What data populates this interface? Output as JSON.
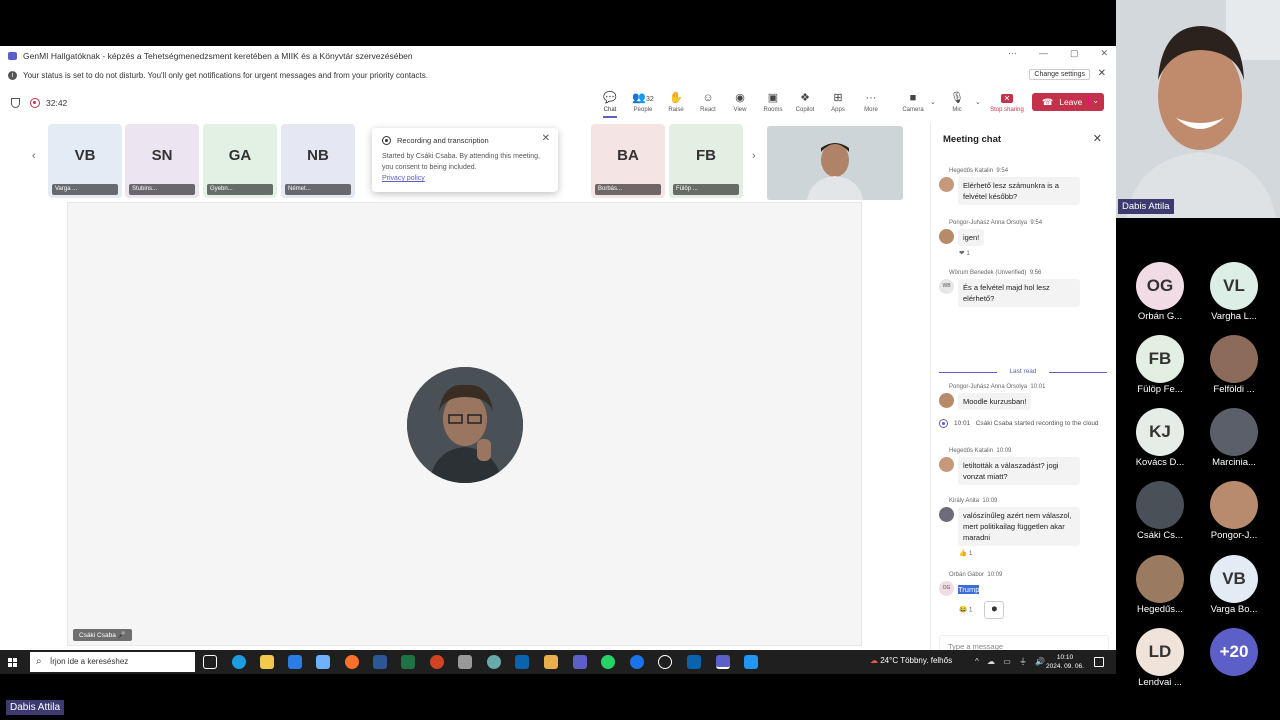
{
  "window": {
    "title": "GenMI Hallgatóknak - képzés a Tehetségmenedzsment keretében a MIIK és a Könyvtár szervezésében",
    "controls": [
      "···",
      "—",
      "▢",
      "✕"
    ]
  },
  "notice": {
    "text": "Your status is set to do not disturb. You'll only get notifications for urgent messages and from your priority contacts.",
    "button": "Change settings"
  },
  "toolbar": {
    "timer": "32:42",
    "tools": [
      {
        "label": "Chat",
        "icon": "chat-icon",
        "glyph": "💬"
      },
      {
        "label": "People",
        "icon": "people-icon",
        "glyph": "👥",
        "count": "32"
      },
      {
        "label": "Raise",
        "icon": "raise-hand-icon",
        "glyph": "✋"
      },
      {
        "label": "React",
        "icon": "react-icon",
        "glyph": "☺"
      },
      {
        "label": "View",
        "icon": "view-icon",
        "glyph": "◉"
      },
      {
        "label": "Rooms",
        "icon": "rooms-icon",
        "glyph": "▣"
      },
      {
        "label": "Copilot",
        "icon": "copilot-icon",
        "glyph": "❖"
      },
      {
        "label": "Apps",
        "icon": "apps-icon",
        "glyph": "⊞"
      },
      {
        "label": "More",
        "icon": "more-icon",
        "glyph": "···"
      },
      {
        "label": "Camera",
        "icon": "camera-icon",
        "glyph": "■"
      },
      {
        "label": "Mic",
        "icon": "mic-icon",
        "glyph": "🎙"
      },
      {
        "label": "Stop sharing",
        "icon": "stop-sharing-icon",
        "glyph": "✕"
      }
    ],
    "leave": "Leave"
  },
  "strip": {
    "participants": [
      {
        "initials": "VB",
        "name": "Varga ...",
        "color": "#e3ecf5"
      },
      {
        "initials": "SN",
        "name": "Stubins...",
        "color": "#ece4f0"
      },
      {
        "initials": "GA",
        "name": "Gyebn...",
        "color": "#e3f0e4"
      },
      {
        "initials": "NB",
        "name": "Német...",
        "color": "#e5e8f3"
      },
      {
        "initials": "BA",
        "name": "Borbás...",
        "color": "#f5e4e4"
      },
      {
        "initials": "FB",
        "name": "Fülöp ...",
        "color": "#e4efe4"
      }
    ]
  },
  "toast": {
    "title": "Recording and transcription",
    "body": "Started by Csáki Csaba. By attending this meeting, you consent to being included.",
    "link": "Privacy policy"
  },
  "stage": {
    "speaker": "Csáki Csaba"
  },
  "chat": {
    "title": "Meeting chat",
    "messages": [
      {
        "author": "Hegedűs Katalin",
        "time": "9:54",
        "text": "Elérhető lesz számunkra is a felvétel később?",
        "avatar": "#c49a7a"
      },
      {
        "author": "Pongor-Juhász Anna Orsolya",
        "time": "9:54",
        "text": "igen!",
        "reaction": "❤ 1",
        "avatar": "#b78a6a"
      },
      {
        "author": "Wörum Benedek (Unverified)",
        "time": "9:56",
        "text": "És a felvétel majd hol lesz elérhető?",
        "initials": "WB",
        "avatar": "#e7e7e7"
      },
      {
        "author": "Pongor-Juhász Anna Orsolya",
        "time": "10:01",
        "text": "Moodle kurzusban!",
        "avatar": "#b78a6a"
      },
      {
        "author": "Hegedűs Katalin",
        "time": "10:09",
        "text": "letiltották a válaszadást? jogi vonzat miatt?",
        "avatar": "#c49a7a"
      },
      {
        "author": "Király Anita",
        "time": "10:09",
        "text": "valószínűleg azért nem válaszol, mert politikailag független akar maradni",
        "reaction": "👍 1",
        "avatar": "#6b6b7a"
      },
      {
        "author": "Orbán Gábor",
        "time": "10:09",
        "text": "Trump",
        "reaction": "😂 1",
        "initials": "OG",
        "avatar": "#f1dce6"
      }
    ],
    "last_read": "Last read",
    "system": {
      "time": "10:01",
      "text": "Csáki Csaba started recording to the cloud"
    },
    "compose_placeholder": "Type a message"
  },
  "taskbar": {
    "search": "Írjon ide a kereséshez",
    "weather": "24°C  Többny. felhős",
    "time": "10:10",
    "date": "2024. 09. 06."
  },
  "gallery": {
    "presenter": "Dabis Attila",
    "people": [
      {
        "initials": "OG",
        "name": "Orbán G...",
        "color": "#f1dce6"
      },
      {
        "initials": "VL",
        "name": "Vargha L...",
        "color": "#ddeee6"
      },
      {
        "initials": "FB",
        "name": "Fülöp Fe...",
        "color": "#e3efe3"
      },
      {
        "initials": "",
        "name": "Felföldi ...",
        "color": "#8c6b5a"
      },
      {
        "initials": "KJ",
        "name": "Kovács D...",
        "color": "#e6ede6"
      },
      {
        "initials": "",
        "name": "Marcinia...",
        "color": "#5a5f6a"
      },
      {
        "initials": "",
        "name": "Csáki Cs...",
        "color": "#4a5058"
      },
      {
        "initials": "",
        "name": "Pongor-J...",
        "color": "#b88a6e"
      },
      {
        "initials": "",
        "name": "Hegedűs...",
        "color": "#9a7a60"
      },
      {
        "initials": "VB",
        "name": "Varga Bo...",
        "color": "#e3ebf5"
      },
      {
        "initials": "LD",
        "name": "Lendvai ...",
        "color": "#efe3da"
      },
      {
        "initials": "+20",
        "name": "",
        "color": "#5b5fc7"
      }
    ]
  },
  "bottom_tag": "Dabis Attila"
}
